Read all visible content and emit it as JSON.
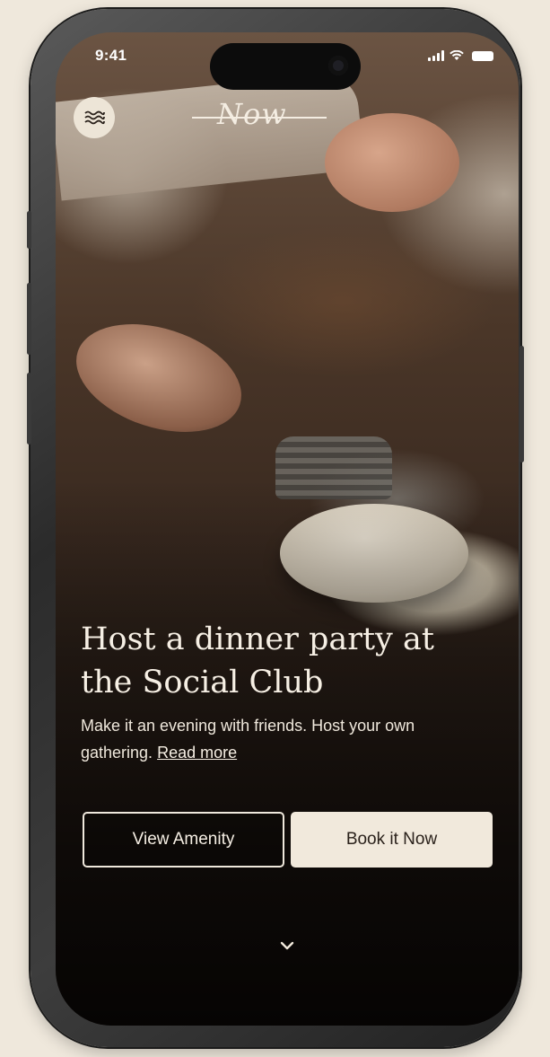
{
  "status_bar": {
    "time": "9:41"
  },
  "header": {
    "logo_text": "Now",
    "menu_icon": "waves-icon"
  },
  "hero": {
    "headline": "Host a dinner party at the Social Club",
    "subtext": "Make it an evening with friends. Host your own gathering.",
    "read_more": "Read more"
  },
  "actions": {
    "view_amenity": "View Amenity",
    "book_now": "Book it Now"
  },
  "scroll_indicator": "chevron-down-icon",
  "colors": {
    "background": "#efe8dc",
    "cream": "#f1e9dc",
    "dark_text": "#2a211b"
  }
}
